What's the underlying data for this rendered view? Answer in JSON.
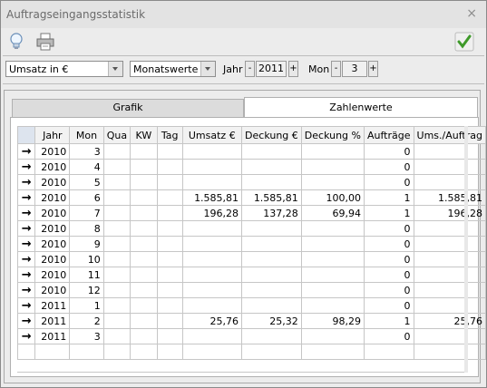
{
  "window": {
    "title": "Auftragseingangsstatistik",
    "close_glyph": "×"
  },
  "toolbar": {
    "icons": [
      "lightbulb-icon",
      "printer-icon",
      "checkmark-icon"
    ]
  },
  "filters": {
    "measure": "Umsatz in €",
    "period": "Monatswerte",
    "jahr_label": "Jahr",
    "jahr_value": "2011",
    "mon_label": "Mon",
    "mon_value": "3",
    "minus": "-",
    "plus": "+"
  },
  "tabs": [
    {
      "label": "Grafik",
      "active": false
    },
    {
      "label": "Zahlenwerte",
      "active": true
    }
  ],
  "table": {
    "columns": [
      "Jahr",
      "Mon",
      "Qua",
      "KW",
      "Tag",
      "Umsatz €",
      "Deckung €",
      "Deckung %",
      "Aufträge",
      "Ums./Auftrag"
    ],
    "row_indicator": "→",
    "rows": [
      [
        "2010",
        "3",
        "",
        "",
        "",
        "",
        "",
        "",
        "0",
        ""
      ],
      [
        "2010",
        "4",
        "",
        "",
        "",
        "",
        "",
        "",
        "0",
        ""
      ],
      [
        "2010",
        "5",
        "",
        "",
        "",
        "",
        "",
        "",
        "0",
        ""
      ],
      [
        "2010",
        "6",
        "",
        "",
        "",
        "1.585,81",
        "1.585,81",
        "100,00",
        "1",
        "1.585,81"
      ],
      [
        "2010",
        "7",
        "",
        "",
        "",
        "196,28",
        "137,28",
        "69,94",
        "1",
        "196,28"
      ],
      [
        "2010",
        "8",
        "",
        "",
        "",
        "",
        "",
        "",
        "0",
        ""
      ],
      [
        "2010",
        "9",
        "",
        "",
        "",
        "",
        "",
        "",
        "0",
        ""
      ],
      [
        "2010",
        "10",
        "",
        "",
        "",
        "",
        "",
        "",
        "0",
        ""
      ],
      [
        "2010",
        "11",
        "",
        "",
        "",
        "",
        "",
        "",
        "0",
        ""
      ],
      [
        "2010",
        "12",
        "",
        "",
        "",
        "",
        "",
        "",
        "0",
        ""
      ],
      [
        "2011",
        "1",
        "",
        "",
        "",
        "",
        "",
        "",
        "0",
        ""
      ],
      [
        "2011",
        "2",
        "",
        "",
        "",
        "25,76",
        "25,32",
        "98,29",
        "1",
        "25,76"
      ],
      [
        "2011",
        "3",
        "",
        "",
        "",
        "",
        "",
        "",
        "0",
        ""
      ]
    ]
  }
}
